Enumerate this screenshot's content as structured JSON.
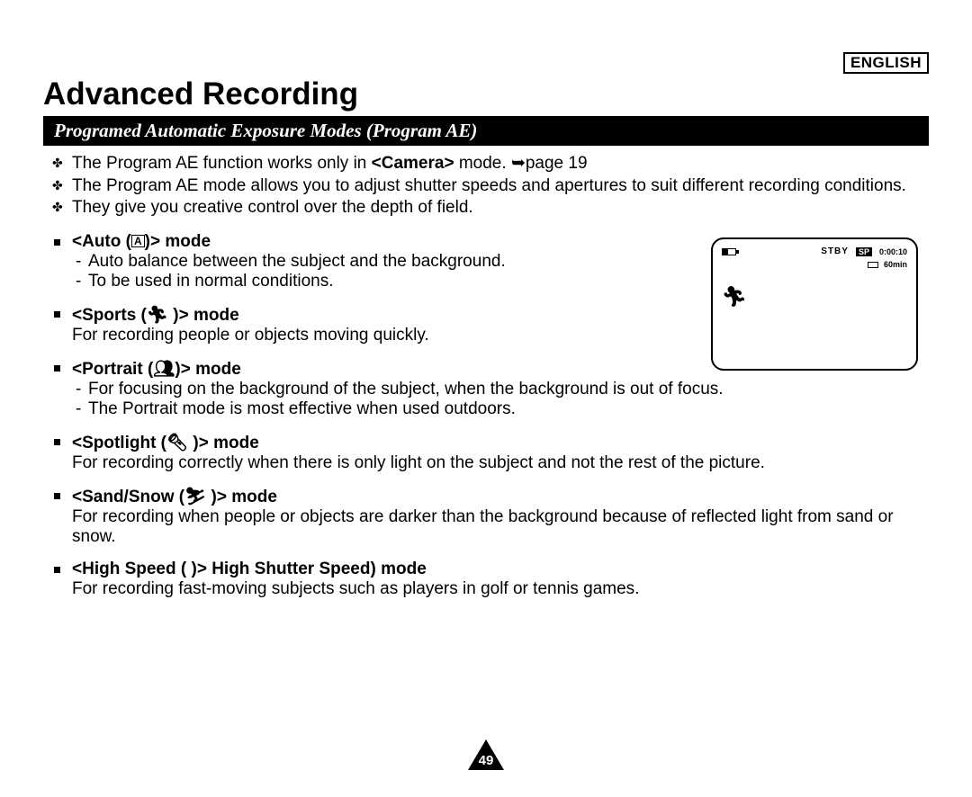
{
  "header": {
    "language": "ENGLISH",
    "title": "Advanced Recording",
    "subhead": "Programed Automatic Exposure Modes (Program AE)"
  },
  "intro": {
    "l1a": "The Program AE function works only in ",
    "l1b": "<Camera>",
    "l1c": " mode. ",
    "l1d": "➥",
    "l1e": "page 19",
    "l2": "The Program AE mode allows you to adjust shutter speeds and apertures to suit different recording conditions.",
    "l3": "They give you creative control over the depth of field."
  },
  "modes": {
    "auto": {
      "title_a": "<Auto (",
      "title_icon": "A",
      "title_b": ")> mode",
      "d1": "Auto balance between the subject and the background.",
      "d2": "To be used in normal conditions."
    },
    "sports": {
      "title_a": "<Sports (",
      "title_b": " )> mode",
      "d1": "For recording people or objects moving quickly."
    },
    "portrait": {
      "title_a": "<Portrait  (",
      "title_b": ")> mode",
      "d1": "For focusing on the background of the subject, when the background is out of focus.",
      "d2": "The Portrait mode is most effective when used outdoors."
    },
    "spotlight": {
      "title_a": "<Spotlight (",
      "title_b": " )> mode",
      "d1": "For recording correctly when there is only light on the subject and not the rest of the picture."
    },
    "sandsnow": {
      "title_a": "<Sand/Snow (",
      "title_b": " )> mode",
      "d1": "For recording when people or objects are darker than the background because of reflected light from sand or snow."
    },
    "highspeed": {
      "title_a": "<High Speed (       )> High Shutter Speed) mode",
      "d1": "For recording fast-moving subjects such as players in golf or tennis games."
    }
  },
  "screen": {
    "stby": "STBY",
    "sp": "SP",
    "time": "0:00:10",
    "remain": "60min"
  },
  "page_number": "49"
}
